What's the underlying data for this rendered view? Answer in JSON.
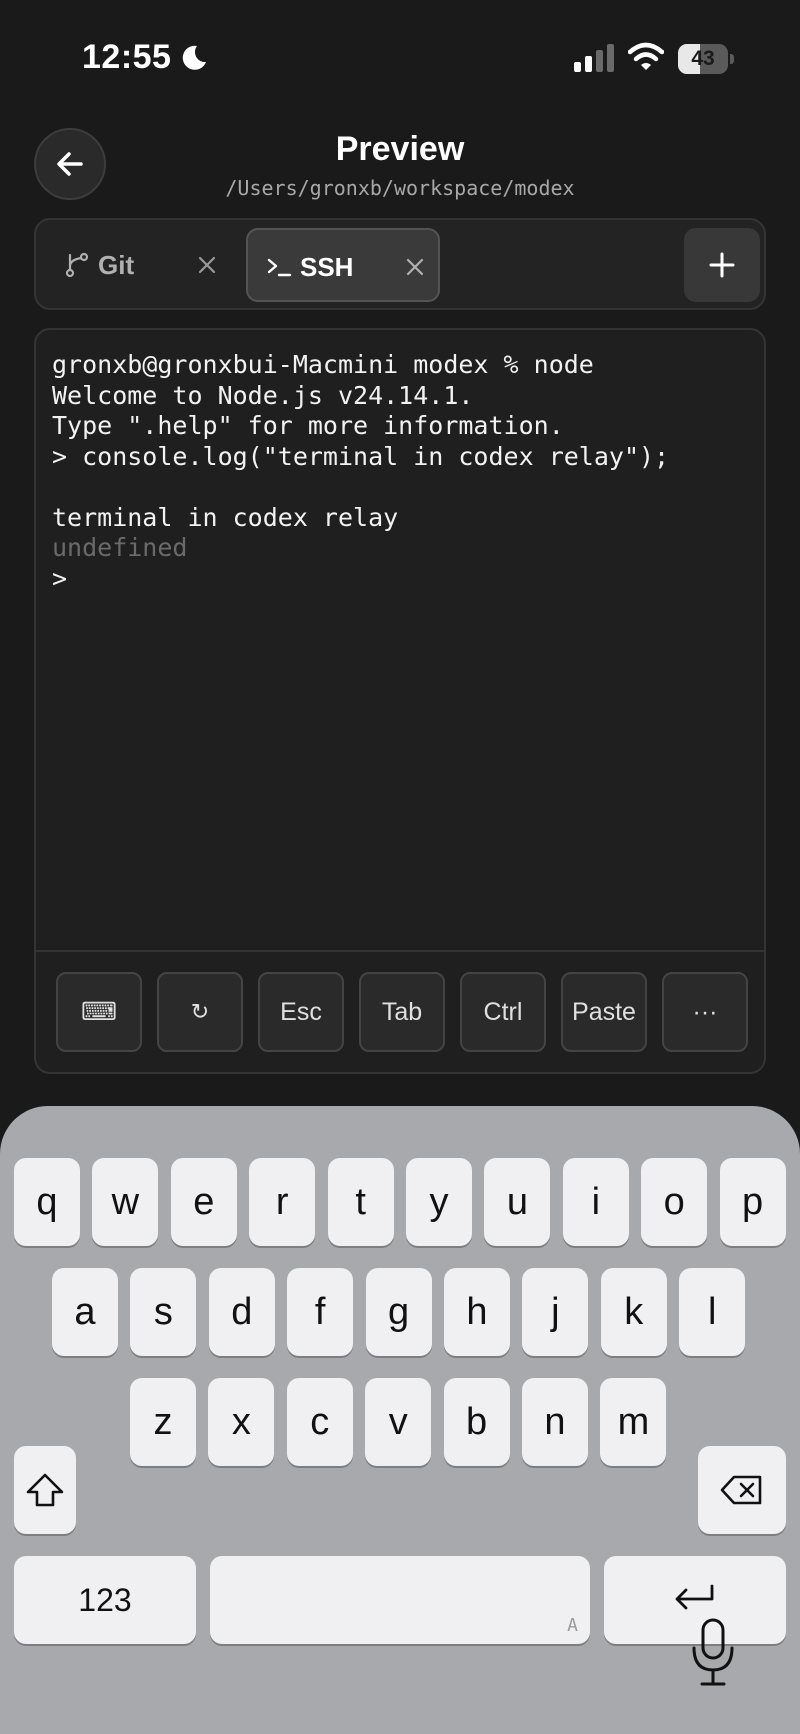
{
  "status_bar": {
    "time": "12:55",
    "battery_level": "43",
    "battery_percent": 43,
    "icons": [
      "moon-icon",
      "cellular-signal-icon",
      "wifi-icon",
      "battery-icon"
    ]
  },
  "header": {
    "back_icon": "arrow-left-icon",
    "title": "Preview",
    "path": "/Users/gronxb/workspace/modex"
  },
  "tabs": [
    {
      "label": "Git",
      "icon": "git-branch-icon",
      "active": false
    },
    {
      "label": "SSH",
      "icon": "terminal-prompt-icon",
      "active": true
    }
  ],
  "add_tab_icon": "plus-icon",
  "terminal": {
    "lines": [
      {
        "text": "gronxb@gronxbui-Macmini modex % node",
        "dim": false
      },
      {
        "text": "Welcome to Node.js v24.14.1.",
        "dim": false
      },
      {
        "text": "Type \".help\" for more information.",
        "dim": false
      },
      {
        "text": "> console.log(\"terminal in codex relay\");",
        "dim": false
      },
      {
        "text": "",
        "dim": false
      },
      {
        "text": "terminal in codex relay",
        "dim": false
      },
      {
        "text": "undefined",
        "dim": true
      },
      {
        "text": ">",
        "dim": false
      }
    ]
  },
  "keybar": {
    "keyboard_glyph": "⌨",
    "refresh_glyph": "↻",
    "esc": "Esc",
    "tab": "Tab",
    "ctrl": "Ctrl",
    "paste": "Paste",
    "more": "···"
  },
  "keyboard": {
    "row1": [
      "q",
      "w",
      "e",
      "r",
      "t",
      "y",
      "u",
      "i",
      "o",
      "p"
    ],
    "row2": [
      "a",
      "s",
      "d",
      "f",
      "g",
      "h",
      "j",
      "k",
      "l"
    ],
    "row3": [
      "z",
      "x",
      "c",
      "v",
      "b",
      "n",
      "m"
    ],
    "numbers_label": "123",
    "space_hint": "A",
    "colors": {
      "background": "#a8a9ad",
      "key": "#f0f0f2"
    }
  },
  "colors": {
    "app_background": "#1a1a1a",
    "panel": "#232323",
    "active_tab": "#3a3a3a",
    "dim_text": "#6a6a6a"
  }
}
